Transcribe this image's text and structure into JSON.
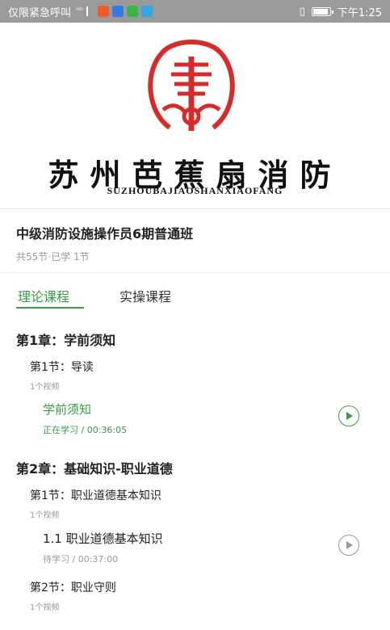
{
  "status_bar": {
    "carrier": "仅限紧急呼叫",
    "signal": "ᴴᴰ",
    "icons": [
      "usb-icon",
      "qq-icon",
      "mail-icon",
      "wechat-icon",
      "message-icon"
    ],
    "battery_level": 0.95,
    "time": "下午1:25"
  },
  "brand": {
    "name_cn": "苏州芭蕉扇消防",
    "name_en": "SUZHOUBAJIAOSHANXIAOFANG",
    "seal_color": "#d42c2a"
  },
  "course": {
    "title": "中级消防设施操作员6期普通班",
    "meta": "共55节·已学 1节"
  },
  "tabs": [
    {
      "label": "理论课程",
      "active": true
    },
    {
      "label": "实操课程",
      "active": false
    }
  ],
  "chapters": [
    {
      "title": "第1章：学前须知",
      "sections": [
        {
          "title": "第1节：导读",
          "count": "1个视频",
          "lessons": [
            {
              "title": "学前须知",
              "status": "正在学习 / 00:36:05",
              "active": true
            }
          ]
        }
      ]
    },
    {
      "title": "第2章：基础知识-职业道德",
      "sections": [
        {
          "title": "第1节：职业道德基本知识",
          "count": "1个视频",
          "lessons": [
            {
              "title": "1.1 职业道德基本知识",
              "status": "待学习 / 00:37:00",
              "active": false
            }
          ]
        },
        {
          "title": "第2节：职业守则",
          "count": "1个视频",
          "lessons": []
        }
      ]
    }
  ],
  "colors": {
    "accent": "#3a9a48",
    "status_bar": "#9a9a9a",
    "muted": "#999999"
  }
}
